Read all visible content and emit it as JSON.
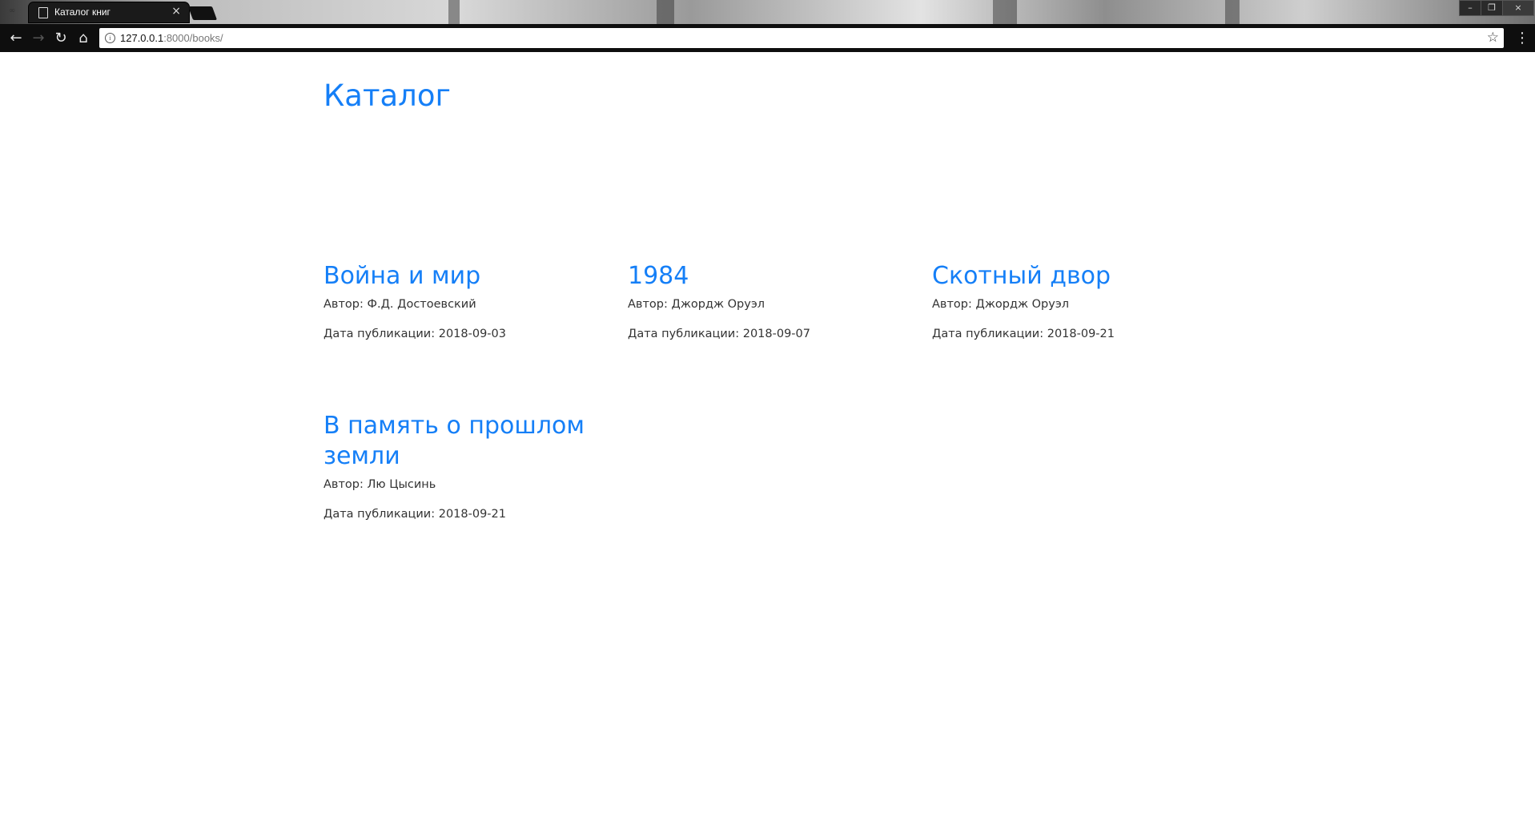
{
  "browser": {
    "tab_title": "Каталог книг",
    "tab_close": "×",
    "url_host": "127.0.0.1",
    "url_rest": ":8000/books/",
    "star": "☆",
    "menu": "⋮",
    "back": "←",
    "forward": "→",
    "reload": "↻",
    "home": "⌂",
    "min": "–",
    "max": "❐",
    "close": "×"
  },
  "page": {
    "title": "Каталог",
    "author_label": "Автор:",
    "date_label": "Дата публикации:"
  },
  "books": [
    {
      "title": "Война и мир",
      "author": "Ф.Д. Достоевский",
      "date": "2018-09-03"
    },
    {
      "title": "1984",
      "author": "Джордж Оруэл",
      "date": "2018-09-07"
    },
    {
      "title": "Скотный двор",
      "author": "Джордж Оруэл",
      "date": "2018-09-21"
    },
    {
      "title": "В память о прошлом земли",
      "author": "Лю Цысинь",
      "date": "2018-09-21"
    }
  ],
  "colors": {
    "accent": "#157ff7",
    "text": "#333333",
    "chrome": "#0e0e0e"
  }
}
